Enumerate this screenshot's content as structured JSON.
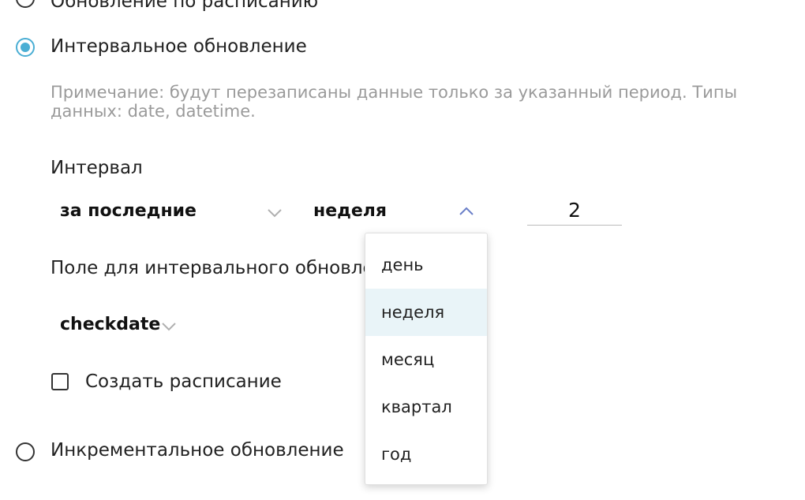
{
  "options": {
    "schedule_update": "Обновление по расписанию",
    "interval_update": "Интервальное обновление",
    "incremental_update": "Инкрементальное обновление"
  },
  "note": "Примечание: будут перезаписаны данные только за указанный период. Типы данных: date, datetime.",
  "interval": {
    "label": "Интервал",
    "mode_value": "за последние",
    "unit_value": "неделя",
    "count_value": "2"
  },
  "field": {
    "label": "Поле для интервального обновле",
    "value": "checkdate"
  },
  "create_schedule_label": "Создать расписание",
  "dropdown": {
    "items": [
      "день",
      "неделя",
      "месяц",
      "квартал",
      "год"
    ],
    "selected_index": 1
  },
  "colors": {
    "accent": "#4aaed4",
    "chevron": "#b0b0b0",
    "chevron_open": "#6a7fc8",
    "highlight": "#e9f4f8"
  },
  "icons": {
    "chevron_down": "chevron-down-icon",
    "chevron_up": "chevron-up-icon"
  }
}
